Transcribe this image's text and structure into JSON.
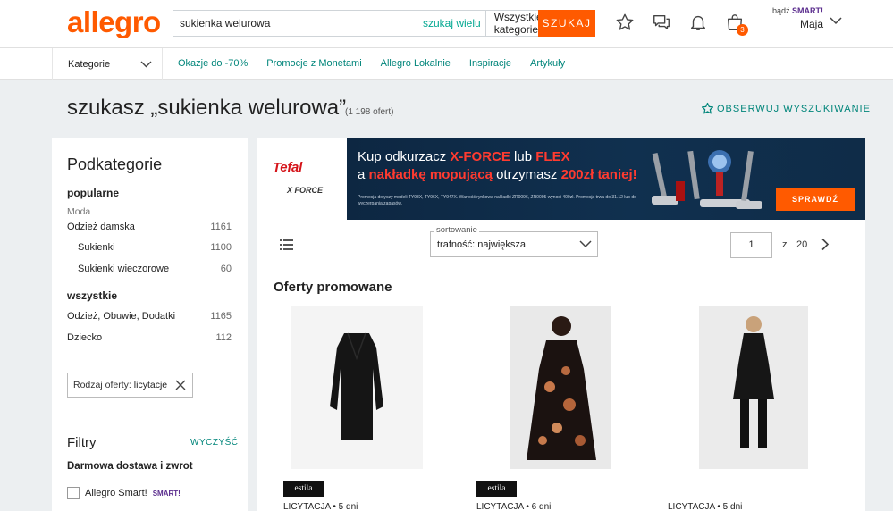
{
  "header": {
    "logo": "allegro",
    "search_value": "sukienka welurowa",
    "search_many": "szukaj wielu",
    "search_category": "Wszystkie kategorie",
    "search_button": "SZUKAJ",
    "cart_count": "3",
    "user_prefix": "bądź",
    "user_smart": "SMART!",
    "user_name": "Maja"
  },
  "nav": {
    "categories": "Kategorie",
    "links": [
      "Okazje do -70%",
      "Promocje z Monetami",
      "Allegro Lokalnie",
      "Inspiracje",
      "Artykuły"
    ]
  },
  "title": {
    "text": "szukasz „sukienka welurowa”",
    "count": "(1 198 ofert)",
    "observe": "OBSERWUJ WYSZUKIWANIE"
  },
  "sidebar": {
    "title": "Podkategorie",
    "popular_heading": "popularne",
    "popular_group": "Moda",
    "popular": [
      {
        "label": "Odzież damska",
        "count": "1161"
      },
      {
        "label": "Sukienki",
        "count": "1100"
      },
      {
        "label": "Sukienki wieczorowe",
        "count": "60"
      }
    ],
    "all_heading": "wszystkie",
    "all": [
      {
        "label": "Odzież, Obuwie, Dodatki",
        "count": "1165"
      },
      {
        "label": "Dziecko",
        "count": "112"
      }
    ],
    "chip_label": "Rodzaj oferty:",
    "chip_value": "licytacje",
    "filters_title": "Filtry",
    "clear": "WYCZYŚĆ",
    "delivery_heading": "Darmowa dostawa i zwrot",
    "smart_checkbox": "Allegro Smart!",
    "smart_badge": "SMART!"
  },
  "banner": {
    "brand": "Tefal",
    "subbrand": "X FORCE",
    "line1_a": "Kup odkurzacz ",
    "line1_b": "X-FORCE",
    "line1_c": " lub ",
    "line1_d": "FLEX",
    "line2_a": "a ",
    "line2_b": "nakładkę mopującą",
    "line2_c": " otrzymasz ",
    "line2_d": "200zł taniej!",
    "fine": "Promocja dotyczy modeli TY98X, TY96X, TY947X. Wartość rynkowa nakładki ZR0096, ZR0095 wynosi 400zł. Promocja trwa do 31.12 lub do wyczerpania zapasów.",
    "cta": "SPRAWDŹ"
  },
  "toolbar": {
    "sort_label": "sortowanie",
    "sort_value": "trafność: największa",
    "page": "1",
    "page_of": "z",
    "page_total": "20"
  },
  "promo": {
    "title": "Oferty promowane",
    "products": [
      {
        "seller": "estila",
        "meta": "LICYTACJA • 5 dni"
      },
      {
        "seller": "estila",
        "meta": "LICYTACJA • 6 dni"
      },
      {
        "seller": "",
        "meta": "LICYTACJA • 5 dni"
      }
    ]
  },
  "colors": {
    "brand": "#ff5a00",
    "link": "#00857a",
    "smart": "#5b2d8e"
  }
}
